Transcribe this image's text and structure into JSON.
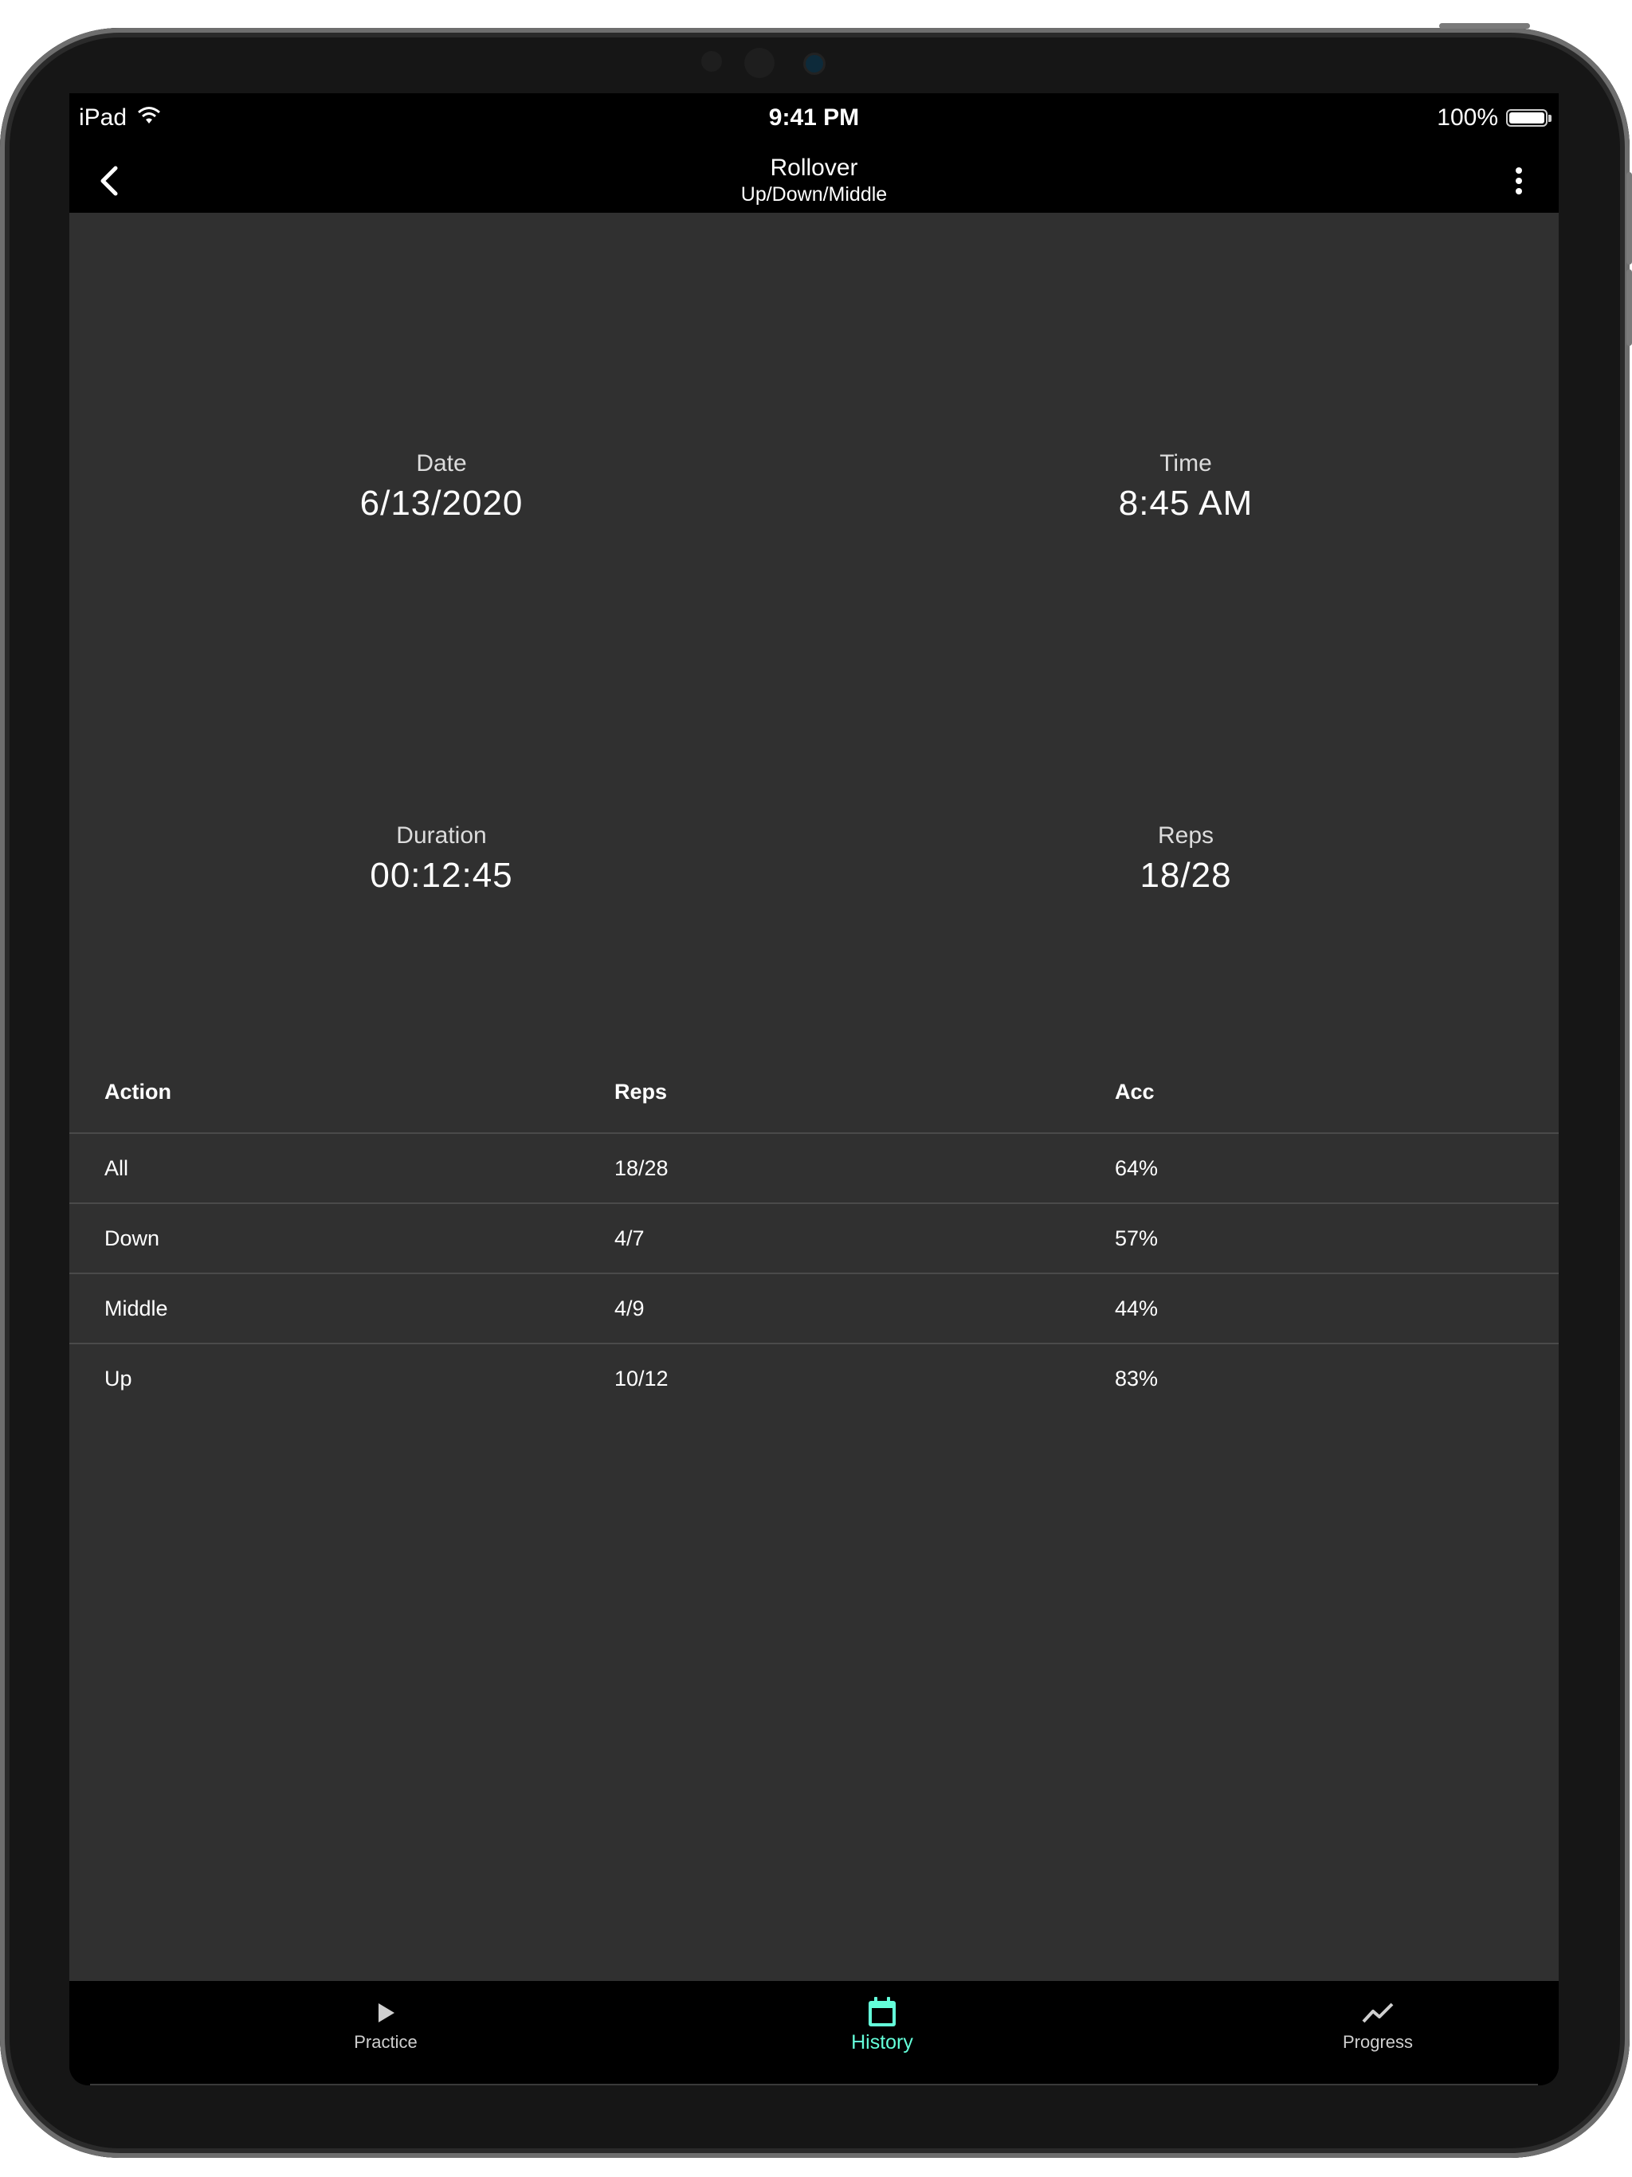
{
  "status_bar": {
    "device": "iPad",
    "time": "9:41 PM",
    "battery": "100%",
    "battery_level": 1.0
  },
  "app_bar": {
    "title": "Rollover",
    "subtitle": "Up/Down/Middle",
    "back_icon": "chevron-left-icon",
    "menu_icon": "more-vert-icon"
  },
  "summary": {
    "date_label": "Date",
    "date_value": "6/13/2020",
    "time_label": "Time",
    "time_value": "8:45 AM",
    "duration_label": "Duration",
    "duration_value": "00:12:45",
    "reps_label": "Reps",
    "reps_value": "18/28"
  },
  "table": {
    "headers": [
      "Action",
      "Reps",
      "Acc"
    ],
    "rows": [
      [
        "All",
        "18/28",
        "64%"
      ],
      [
        "Down",
        "4/7",
        "57%"
      ],
      [
        "Middle",
        "4/9",
        "44%"
      ],
      [
        "Up",
        "10/12",
        "83%"
      ]
    ]
  },
  "fab": {
    "icon": "play-icon"
  },
  "bottom_nav": {
    "items": [
      {
        "label": "Practice",
        "icon": "play-icon",
        "active": false
      },
      {
        "label": "History",
        "icon": "calendar-icon",
        "active": true
      },
      {
        "label": "Progress",
        "icon": "trend-line-icon",
        "active": false
      }
    ]
  },
  "colors": {
    "accent": "#64ffda",
    "background": "#303030",
    "bar": "#000000"
  }
}
